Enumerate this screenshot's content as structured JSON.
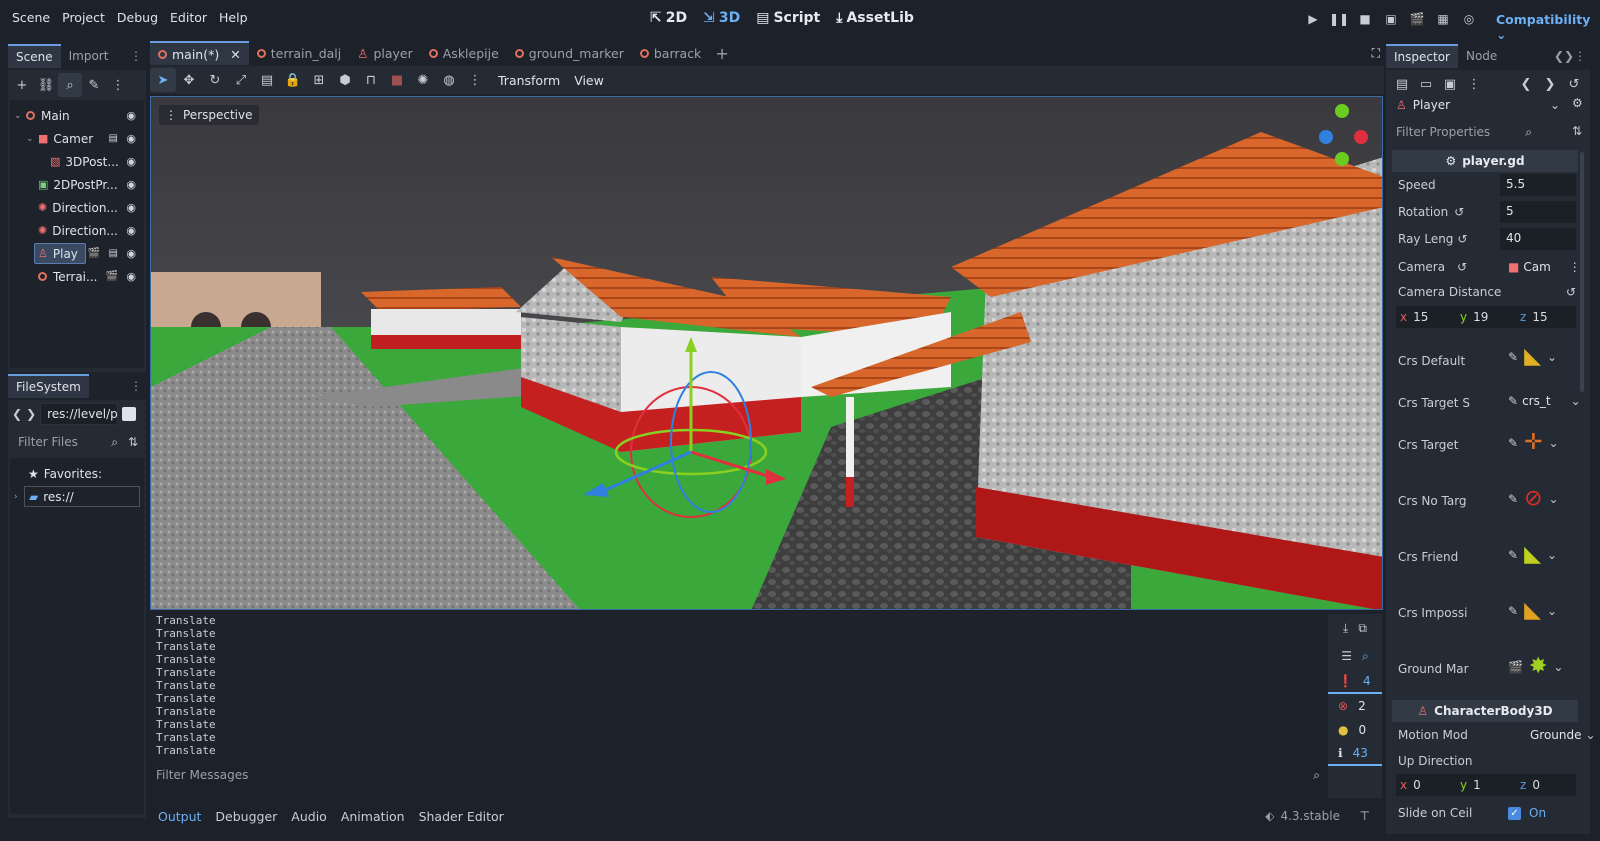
{
  "menu": [
    "Scene",
    "Project",
    "Debug",
    "Editor",
    "Help"
  ],
  "workspaces": [
    {
      "label": "2D",
      "icon": "2d-icon"
    },
    {
      "label": "3D",
      "icon": "3d-icon",
      "active": true
    },
    {
      "label": "Script",
      "icon": "script-icon"
    },
    {
      "label": "AssetLib",
      "icon": "assetlib-icon"
    }
  ],
  "renderer": "Compatibility",
  "scene_dock": {
    "tabs": [
      "Scene",
      "Import"
    ],
    "tree": [
      {
        "label": "Main",
        "depth": 0,
        "icon": "node3d-icon",
        "color": "#f07070"
      },
      {
        "label": "Camer",
        "depth": 1,
        "icon": "camera-icon",
        "color": "#f07070"
      },
      {
        "label": "3DPost...",
        "depth": 2,
        "icon": "mesh-icon",
        "color": "#f07070"
      },
      {
        "label": "2DPostPr...",
        "depth": 1,
        "icon": "control-icon",
        "color": "#7ad07a"
      },
      {
        "label": "Direction...",
        "depth": 1,
        "icon": "light-icon",
        "color": "#f07070"
      },
      {
        "label": "Direction...",
        "depth": 1,
        "icon": "light-icon",
        "color": "#f07070"
      },
      {
        "label": "Play",
        "depth": 1,
        "icon": "character-icon",
        "color": "#f07070",
        "selected": true
      },
      {
        "label": "Terrai...",
        "depth": 1,
        "icon": "node3d-icon",
        "color": "#f07070"
      }
    ]
  },
  "filesystem": {
    "title": "FileSystem",
    "path": "res://level/p",
    "filter_placeholder": "Filter Files",
    "favorites": "Favorites:",
    "root": "res://"
  },
  "editor_tabs": [
    "main(*)",
    "terrain_dalj",
    "player",
    "Asklepije",
    "ground_marker",
    "barrack"
  ],
  "toolbar": {
    "transform": "Transform",
    "view": "View"
  },
  "viewport": {
    "perspective": "Perspective"
  },
  "output": {
    "lines": [
      "Translate",
      "Translate",
      "Translate",
      "Translate",
      "Translate",
      "Translate",
      "Translate",
      "Translate",
      "Translate",
      "Translate",
      "Translate"
    ],
    "filter_placeholder": "Filter Messages",
    "counts": {
      "errors": "4",
      "warnings_err": "2",
      "warnings": "0",
      "info": "43"
    }
  },
  "bottom_tabs": [
    "Output",
    "Debugger",
    "Audio",
    "Animation",
    "Shader Editor"
  ],
  "version": "4.3.stable",
  "inspector": {
    "tabs": [
      "Inspector",
      "Node"
    ],
    "node_name": "Player",
    "filter_placeholder": "Filter Properties",
    "script_section": "player.gd",
    "speed_label": "Speed",
    "speed": "5.5",
    "rotation_label": "Rotation",
    "rotation": "5",
    "ray_label": "Ray Leng",
    "ray": "40",
    "camera_label": "Camera",
    "camera": "Cam",
    "camdist_label": "Camera Distance",
    "camdist": {
      "x": "15",
      "y": "19",
      "z": "15"
    },
    "crs_default": "Crs Default",
    "crs_target_s": "Crs Target S",
    "crs_target_s_val": "crs_t",
    "crs_target": "Crs Target",
    "crs_no_targ": "Crs No Targ",
    "crs_friend": "Crs Friend",
    "crs_impossi": "Crs Impossi",
    "ground_mar": "Ground Mar",
    "body_section": "CharacterBody3D",
    "motion_label": "Motion Mod",
    "motion": "Grounde",
    "up_label": "Up Direction",
    "up": {
      "x": "0",
      "y": "1",
      "z": "0"
    },
    "slide_label": "Slide on Ceil",
    "slide": "On"
  }
}
